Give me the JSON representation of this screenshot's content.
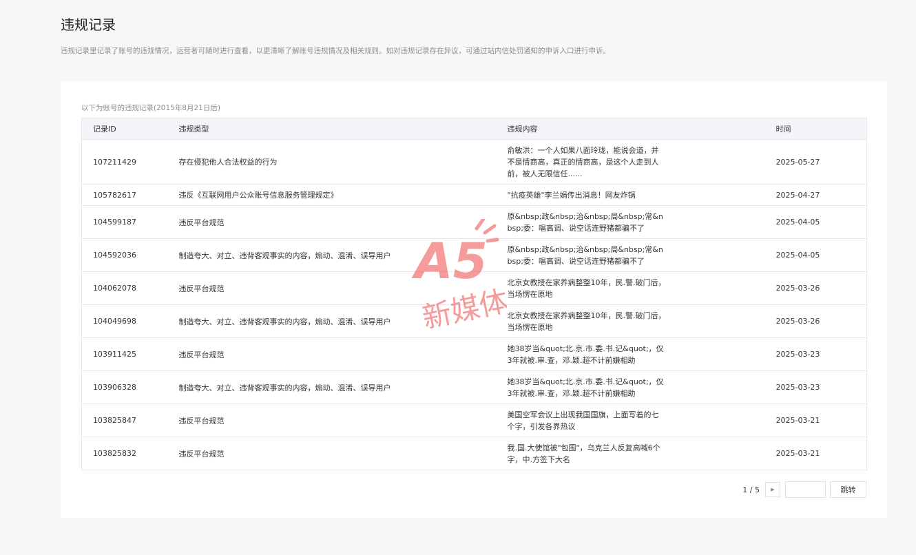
{
  "page": {
    "title": "违规记录",
    "description": "违规记录里记录了账号的违规情况，运营者可随时进行查看，以更清晰了解账号违规情况及相关规则。如对违规记录存在异议，可通过站内信处罚通知的申诉入口进行申诉。"
  },
  "table": {
    "caption": "以下为账号的违规记录(2015年8月21日后)",
    "headers": [
      "记录ID",
      "违规类型",
      "违规内容",
      "时间"
    ],
    "rows": [
      {
        "id": "107211429",
        "type": "存在侵犯他人合法权益的行为",
        "content": "俞敏洪：一个人如果八面玲珑，能说会道，并不是情商高，真正的情商高，是这个人走到人前，被人无限信任......",
        "time": "2025-05-27"
      },
      {
        "id": "105782617",
        "type": "违反《互联网用户公众账号信息服务管理规定》",
        "content": "\"抗疫英雄\"李兰娟传出消息！网友炸锅",
        "time": "2025-04-27"
      },
      {
        "id": "104599187",
        "type": "违反平台规范",
        "content": "原&nbsp;政&nbsp;治&nbsp;局&nbsp;常&nbsp;委：唱高调、说空话连野猪都骗不了",
        "time": "2025-04-05"
      },
      {
        "id": "104592036",
        "type": "制造夸大、对立、违背客观事实的内容，煽动、混淆、误导用户",
        "content": "原&nbsp;政&nbsp;治&nbsp;局&nbsp;常&nbsp;委：唱高调、说空话连野猪都骗不了",
        "time": "2025-04-05"
      },
      {
        "id": "104062078",
        "type": "违反平台规范",
        "content": "北京女教授在家养病整整10年，民.警.破门后，当场愣在原地",
        "time": "2025-03-26"
      },
      {
        "id": "104049698",
        "type": "制造夸大、对立、违背客观事实的内容，煽动、混淆、误导用户",
        "content": "北京女教授在家养病整整10年，民.警.破门后，当场愣在原地",
        "time": "2025-03-26"
      },
      {
        "id": "103911425",
        "type": "违反平台规范",
        "content": "她38岁当&quot;北.京.市.委.书.记&quot;，仅3年就被.审.查，邓.颖.超不计前嫌相助",
        "time": "2025-03-23"
      },
      {
        "id": "103906328",
        "type": "制造夸大、对立、违背客观事实的内容，煽动、混淆、误导用户",
        "content": "她38岁当&quot;北.京.市.委.书.记&quot;，仅3年就被.审.查，邓.颖.超不计前嫌相助",
        "time": "2025-03-23"
      },
      {
        "id": "103825847",
        "type": "违反平台规范",
        "content": "美国空军会议上出现我国国旗，上面写着的七个字，引发各界热议",
        "time": "2025-03-21"
      },
      {
        "id": "103825832",
        "type": "违反平台规范",
        "content": "我.国.大使馆被\"包围\"，乌克兰人反复高喊6个字，中.方签下大名",
        "time": "2025-03-21"
      }
    ]
  },
  "pagination": {
    "page_indicator": "1 / 5",
    "next_icon": "caret-right-icon",
    "jump_placeholder": "",
    "jump_label": "跳转"
  },
  "watermark": {
    "logo_text": "A5",
    "subtitle": "新媒体",
    "color": "#f05a5a"
  }
}
